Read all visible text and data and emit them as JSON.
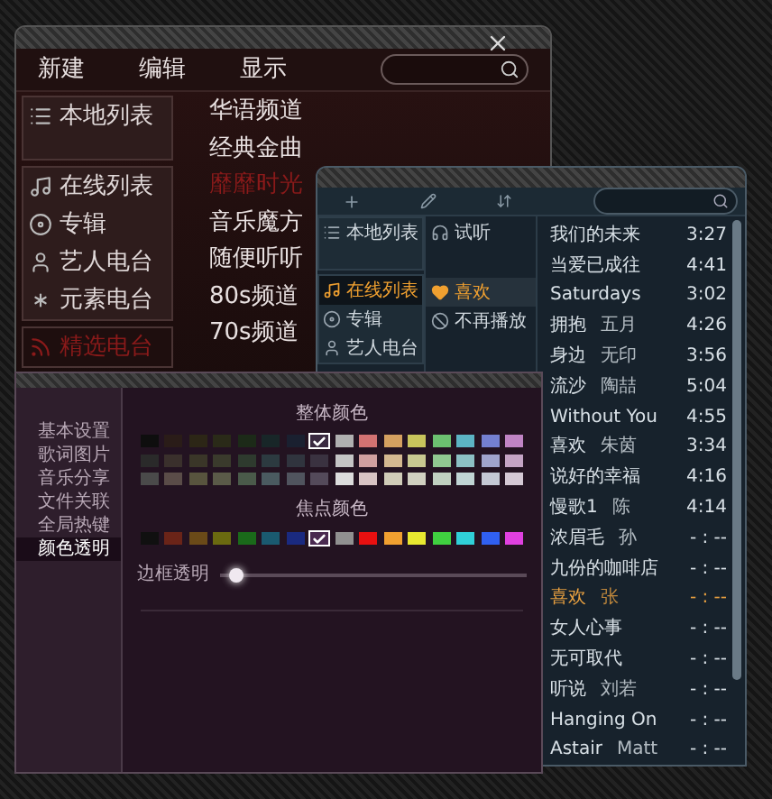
{
  "player_window": {
    "menu": [
      {
        "label": "新建"
      },
      {
        "label": "编辑"
      },
      {
        "label": "显示"
      }
    ],
    "nav_groups": [
      {
        "items": [
          {
            "label": "本地列表",
            "selected": false
          }
        ]
      },
      {
        "items": [
          {
            "label": "在线列表",
            "selected": false
          },
          {
            "label": "专辑",
            "selected": false
          },
          {
            "label": "艺人电台",
            "selected": false
          },
          {
            "label": "元素电台",
            "selected": false
          }
        ]
      },
      {
        "items": [
          {
            "label": "精选电台",
            "selected": true
          }
        ]
      }
    ],
    "channels": [
      {
        "label": "华语频道",
        "selected": false
      },
      {
        "label": "经典金曲",
        "selected": false
      },
      {
        "label": "靡靡时光",
        "selected": true
      },
      {
        "label": "音乐魔方",
        "selected": false
      },
      {
        "label": "随便听听",
        "selected": false
      },
      {
        "label": "80s频道",
        "selected": false
      },
      {
        "label": "70s频道",
        "selected": false
      }
    ]
  },
  "playlist_window": {
    "nav_groups": [
      {
        "items": [
          {
            "label": "本地列表",
            "selected": false
          }
        ]
      },
      {
        "items": [
          {
            "label": "在线列表",
            "selected": true
          },
          {
            "label": "专辑",
            "selected": false
          },
          {
            "label": "艺人电台",
            "selected": false
          }
        ]
      }
    ],
    "lists": [
      {
        "label": "试听",
        "selected": false
      },
      {
        "label": "喜欢",
        "selected": true
      },
      {
        "label": "不再播放",
        "selected": false
      }
    ],
    "songs": [
      {
        "title": "我们的未来",
        "time": "3:27",
        "selected": false
      },
      {
        "title": "当爱已成往",
        "time": "4:41",
        "selected": false
      },
      {
        "title": "Saturdays",
        "time": "3:02",
        "selected": false
      },
      {
        "title": "拥抱",
        "artist": "五月",
        "time": "4:26",
        "selected": false
      },
      {
        "title": "身边",
        "artist": "无印",
        "time": "3:56",
        "selected": false
      },
      {
        "title": "流沙",
        "artist": "陶喆",
        "time": "5:04",
        "selected": false
      },
      {
        "title": "Without You",
        "time": "4:55",
        "selected": false
      },
      {
        "title": "喜欢",
        "artist": "朱茵",
        "time": "3:34",
        "selected": false
      },
      {
        "title": "说好的幸福",
        "time": "4:16",
        "selected": false
      },
      {
        "title": "慢歌1",
        "artist": "陈",
        "time": "4:14",
        "selected": false
      },
      {
        "title": "浓眉毛",
        "artist": "孙",
        "time": "- : --",
        "selected": false
      },
      {
        "title": "九份的咖啡店",
        "time": "- : --",
        "selected": false
      },
      {
        "title": "喜欢",
        "artist": "张",
        "time": "- : --",
        "selected": true
      },
      {
        "title": "女人心事",
        "time": "- : --",
        "selected": false
      },
      {
        "title": "无可取代",
        "time": "- : --",
        "selected": false
      },
      {
        "title": "听说",
        "artist": "刘若",
        "time": "- : --",
        "selected": false
      },
      {
        "title": "Hanging On",
        "time": "- : --",
        "selected": false
      },
      {
        "title": "Astair",
        "artist": "Matt",
        "time": "- : --",
        "selected": false
      }
    ]
  },
  "settings_window": {
    "nav": [
      {
        "label": "基本设置",
        "selected": false
      },
      {
        "label": "歌词图片",
        "selected": false
      },
      {
        "label": "音乐分享",
        "selected": false
      },
      {
        "label": "文件关联",
        "selected": false
      },
      {
        "label": "全局热键",
        "selected": false
      },
      {
        "label": "颜色透明",
        "selected": true
      }
    ],
    "overall_title": "整体颜色",
    "overall_colors": [
      {
        "swatches": [
          {
            "color": "#0e0e0e",
            "selected": false
          },
          {
            "color": "#2a1c18",
            "selected": false
          },
          {
            "color": "#2c2616",
            "selected": false
          },
          {
            "color": "#2a2a18",
            "selected": false
          },
          {
            "color": "#1c2a18",
            "selected": false
          },
          {
            "color": "#182628",
            "selected": false
          },
          {
            "color": "#1a2030",
            "selected": false
          },
          {
            "color": "#3a2a40",
            "selected": true
          },
          {
            "color": "#b0b0b0",
            "selected": false
          },
          {
            "color": "#d27272",
            "selected": false
          },
          {
            "color": "#d4a060",
            "selected": false
          },
          {
            "color": "#c8c45c",
            "selected": false
          },
          {
            "color": "#6cc070",
            "selected": false
          },
          {
            "color": "#5cb4c4",
            "selected": false
          },
          {
            "color": "#7480d0",
            "selected": false
          },
          {
            "color": "#c084c4",
            "selected": false
          }
        ]
      },
      {
        "swatches": [
          {
            "color": "#2a2a2a",
            "selected": false
          },
          {
            "color": "#3a302c",
            "selected": false
          },
          {
            "color": "#3a3628",
            "selected": false
          },
          {
            "color": "#3a3a2c",
            "selected": false
          },
          {
            "color": "#2e3a2e",
            "selected": false
          },
          {
            "color": "#2c3a40",
            "selected": false
          },
          {
            "color": "#30343e",
            "selected": false
          },
          {
            "color": "#3a3240",
            "selected": false
          },
          {
            "color": "#c4c4c4",
            "selected": false
          },
          {
            "color": "#d0a0a0",
            "selected": false
          },
          {
            "color": "#d4b890",
            "selected": false
          },
          {
            "color": "#c8c890",
            "selected": false
          },
          {
            "color": "#90c890",
            "selected": false
          },
          {
            "color": "#8cc0c4",
            "selected": false
          },
          {
            "color": "#a0a4cc",
            "selected": false
          },
          {
            "color": "#c4a4c4",
            "selected": false
          }
        ]
      },
      {
        "swatches": [
          {
            "color": "#4a4a4a",
            "selected": false
          },
          {
            "color": "#5a4c48",
            "selected": false
          },
          {
            "color": "#58543e",
            "selected": false
          },
          {
            "color": "#5a5a48",
            "selected": false
          },
          {
            "color": "#4a5a4a",
            "selected": false
          },
          {
            "color": "#4a5a60",
            "selected": false
          },
          {
            "color": "#50545e",
            "selected": false
          },
          {
            "color": "#544a5a",
            "selected": false
          },
          {
            "color": "#dcdcdc",
            "selected": false
          },
          {
            "color": "#d8c4c4",
            "selected": false
          },
          {
            "color": "#d0ccb8",
            "selected": false
          },
          {
            "color": "#d0d0c0",
            "selected": false
          },
          {
            "color": "#c0d0c0",
            "selected": false
          },
          {
            "color": "#c0d4d4",
            "selected": false
          },
          {
            "color": "#c4c8d4",
            "selected": false
          },
          {
            "color": "#d4c8d4",
            "selected": false
          }
        ]
      }
    ],
    "focus_title": "焦点颜色",
    "focus_colors": [
      {
        "color": "#101010",
        "selected": false
      },
      {
        "color": "#6a2418",
        "selected": false
      },
      {
        "color": "#6a4a18",
        "selected": false
      },
      {
        "color": "#6a6a10",
        "selected": false
      },
      {
        "color": "#1a6a1a",
        "selected": false
      },
      {
        "color": "#1a5a70",
        "selected": false
      },
      {
        "color": "#1a2a80",
        "selected": false
      },
      {
        "color": "#4a2a50",
        "selected": true
      },
      {
        "color": "#909090",
        "selected": false
      },
      {
        "color": "#e81010",
        "selected": false
      },
      {
        "color": "#f0a030",
        "selected": false
      },
      {
        "color": "#e8e830",
        "selected": false
      },
      {
        "color": "#40d040",
        "selected": false
      },
      {
        "color": "#30d0d8",
        "selected": false
      },
      {
        "color": "#3060f0",
        "selected": false
      },
      {
        "color": "#e040e0",
        "selected": false
      }
    ],
    "border_opacity": {
      "label": "边框透明",
      "level": 0.05
    }
  }
}
